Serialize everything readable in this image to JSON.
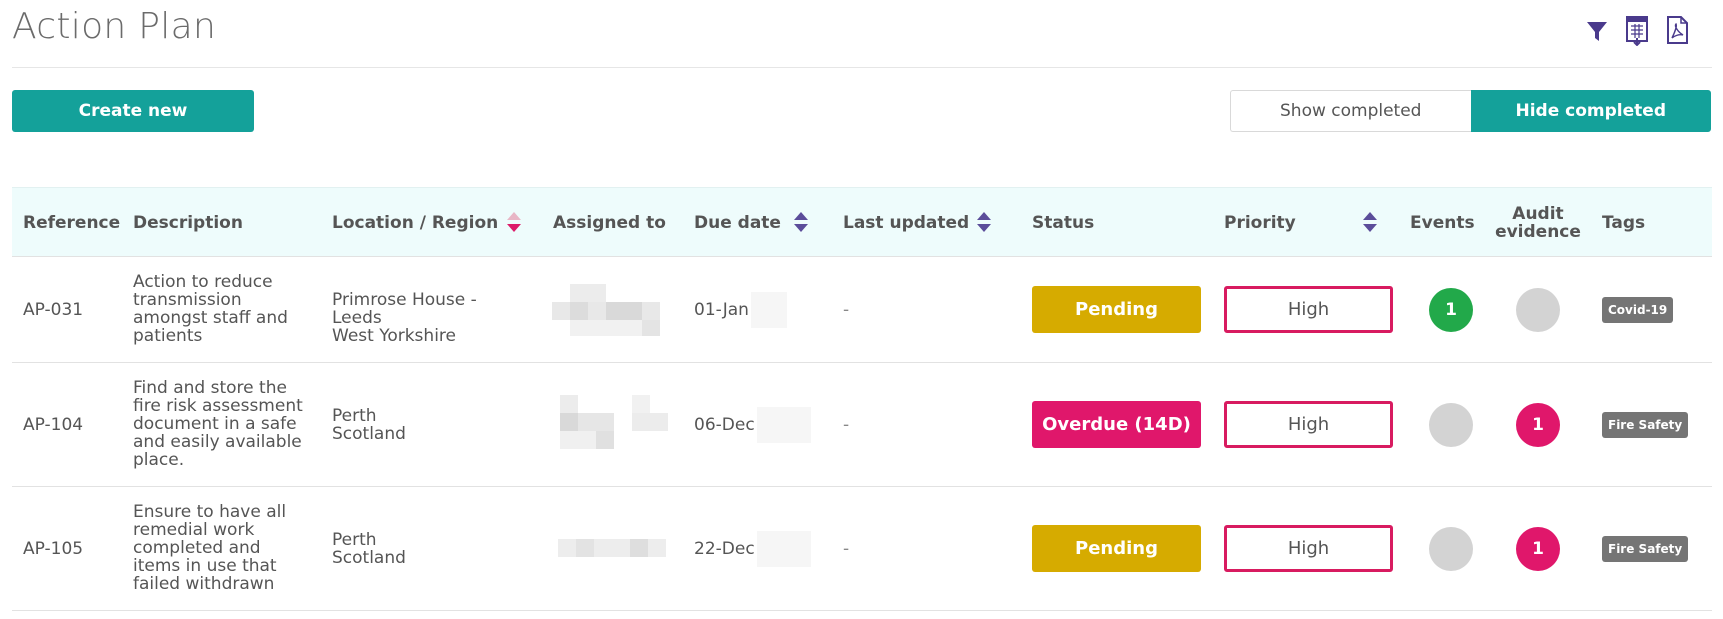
{
  "page": {
    "title": "Action Plan"
  },
  "toolbar": {
    "icons": [
      "filter-icon",
      "csv-export-icon",
      "pdf-export-icon"
    ],
    "create_label": "Create new",
    "show_completed_label": "Show completed",
    "hide_completed_label": "Hide completed",
    "active_toggle": "hide_completed"
  },
  "colors": {
    "accent": "#14a19a",
    "pending": "#d6ab00",
    "overdue": "#e0176b",
    "priority_border": "#d81b60",
    "events_green": "#22a94a",
    "count_pink": "#e0176b",
    "empty_circle": "#d3d3d3",
    "tag": "#757575",
    "sort_icon": "#5b4d9a"
  },
  "table": {
    "columns": {
      "reference": "Reference",
      "description": "Description",
      "location": "Location / Region",
      "assigned": "Assigned to",
      "due": "Due date",
      "updated": "Last updated",
      "status": "Status",
      "priority": "Priority",
      "events": "Events",
      "audit": "Audit evidence",
      "tags": "Tags"
    },
    "sorted_column": "Location / Region",
    "rows": [
      {
        "reference": "AP-031",
        "description": "Action to reduce transmission amongst staff and patients",
        "location": "Primrose House - Leeds",
        "region": "West Yorkshire",
        "due_date": "01-Jan",
        "last_updated": "-",
        "status": "Pending",
        "priority": "High",
        "events": "1",
        "audit_evidence": "",
        "tag": "Covid-19"
      },
      {
        "reference": "AP-104",
        "description": "Find and store the fire risk assessment document in a safe and easily available place.",
        "location": "Perth",
        "region": "Scotland",
        "due_date": "06-Dec",
        "last_updated": "-",
        "status": "Overdue (14D)",
        "priority": "High",
        "events": "",
        "audit_evidence": "1",
        "tag": "Fire Safety"
      },
      {
        "reference": "AP-105",
        "description": "Ensure to have all remedial work completed and items in use that failed withdrawn",
        "location": "Perth",
        "region": "Scotland",
        "due_date": "22-Dec",
        "last_updated": "-",
        "status": "Pending",
        "priority": "High",
        "events": "",
        "audit_evidence": "1",
        "tag": "Fire Safety"
      }
    ]
  }
}
